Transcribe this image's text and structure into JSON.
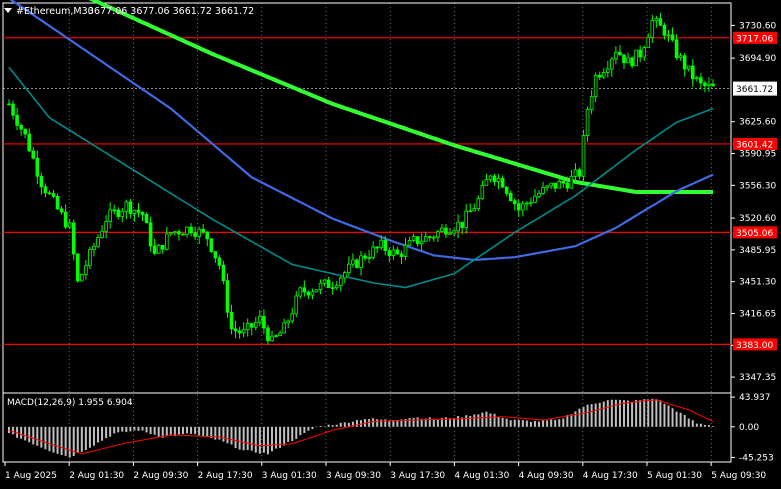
{
  "header": {
    "symbol_label": "#Ethereum,M30",
    "ohlc": "3677.06 3677.06 3661.72 3661.72",
    "menu_icon": "triangle-down-icon"
  },
  "chart_data": {
    "type": "candlestick",
    "timeframe": "M30",
    "colors": {
      "background": "#000000",
      "candles": "#00ff00",
      "ma_200": "#32ff32",
      "ma_blue": "#4169e1",
      "ma_teal": "#008b8b",
      "levels": "#ff0000",
      "grid": "#ffffff",
      "macd_hist": "#c0c0c0",
      "macd_signal": "#ff0000"
    },
    "price_axis": {
      "range": [
        3330,
        3755
      ],
      "ticks": [
        3730.6,
        3694.9,
        3625.6,
        3590.95,
        3556.3,
        3520.6,
        3485.95,
        3451.3,
        3416.65,
        3381.95,
        3347.35
      ]
    },
    "time_axis": {
      "labels": [
        "1 Aug 2025",
        "2 Aug 01:30",
        "2 Aug 09:30",
        "2 Aug 17:30",
        "3 Aug 01:30",
        "3 Aug 09:30",
        "3 Aug 17:30",
        "4 Aug 01:30",
        "4 Aug 09:30",
        "4 Aug 17:30",
        "5 Aug 01:30",
        "5 Aug 09:30"
      ]
    },
    "last_price": 3661.72,
    "horizontal_levels": [
      3717.06,
      3601.42,
      3505.06,
      3383.0
    ],
    "price_path": [
      {
        "t": 0,
        "p": 3645
      },
      {
        "t": 4,
        "p": 3610
      },
      {
        "t": 8,
        "p": 3560
      },
      {
        "t": 12,
        "p": 3530
      },
      {
        "t": 15,
        "p": 3510
      },
      {
        "t": 17,
        "p": 3450
      },
      {
        "t": 20,
        "p": 3480
      },
      {
        "t": 24,
        "p": 3520
      },
      {
        "t": 29,
        "p": 3535
      },
      {
        "t": 33,
        "p": 3525
      },
      {
        "t": 36,
        "p": 3480
      },
      {
        "t": 40,
        "p": 3505
      },
      {
        "t": 45,
        "p": 3510
      },
      {
        "t": 49,
        "p": 3500
      },
      {
        "t": 52,
        "p": 3470
      },
      {
        "t": 55,
        "p": 3400
      },
      {
        "t": 58,
        "p": 3395
      },
      {
        "t": 62,
        "p": 3410
      },
      {
        "t": 65,
        "p": 3385
      },
      {
        "t": 68,
        "p": 3400
      },
      {
        "t": 72,
        "p": 3440
      },
      {
        "t": 76,
        "p": 3445
      },
      {
        "t": 80,
        "p": 3450
      },
      {
        "t": 84,
        "p": 3465
      },
      {
        "t": 88,
        "p": 3480
      },
      {
        "t": 92,
        "p": 3490
      },
      {
        "t": 96,
        "p": 3480
      },
      {
        "t": 100,
        "p": 3495
      },
      {
        "t": 104,
        "p": 3500
      },
      {
        "t": 108,
        "p": 3510
      },
      {
        "t": 112,
        "p": 3515
      },
      {
        "t": 116,
        "p": 3540
      },
      {
        "t": 119,
        "p": 3570
      },
      {
        "t": 122,
        "p": 3560
      },
      {
        "t": 126,
        "p": 3530
      },
      {
        "t": 130,
        "p": 3545
      },
      {
        "t": 134,
        "p": 3555
      },
      {
        "t": 138,
        "p": 3560
      },
      {
        "t": 141,
        "p": 3570
      },
      {
        "t": 143,
        "p": 3640
      },
      {
        "t": 145,
        "p": 3675
      },
      {
        "t": 148,
        "p": 3690
      },
      {
        "t": 150,
        "p": 3705
      },
      {
        "t": 153,
        "p": 3690
      },
      {
        "t": 156,
        "p": 3700
      },
      {
        "t": 159,
        "p": 3735
      },
      {
        "t": 162,
        "p": 3725
      },
      {
        "t": 165,
        "p": 3700
      },
      {
        "t": 168,
        "p": 3680
      },
      {
        "t": 171,
        "p": 3665
      },
      {
        "t": 174,
        "p": 3662
      }
    ],
    "moving_averages": [
      {
        "id": "ma_200",
        "points": [
          {
            "t": 0,
            "p": 3790
          },
          {
            "t": 20,
            "p": 3760
          },
          {
            "t": 50,
            "p": 3700
          },
          {
            "t": 80,
            "p": 3645
          },
          {
            "t": 110,
            "p": 3600
          },
          {
            "t": 140,
            "p": 3560
          },
          {
            "t": 155,
            "p": 3549
          },
          {
            "t": 174,
            "p": 3549
          }
        ]
      },
      {
        "id": "ma_blue",
        "points": [
          {
            "t": 0,
            "p": 3760
          },
          {
            "t": 20,
            "p": 3700
          },
          {
            "t": 40,
            "p": 3640
          },
          {
            "t": 60,
            "p": 3565
          },
          {
            "t": 80,
            "p": 3520
          },
          {
            "t": 95,
            "p": 3495
          },
          {
            "t": 105,
            "p": 3480
          },
          {
            "t": 115,
            "p": 3475
          },
          {
            "t": 125,
            "p": 3478
          },
          {
            "t": 140,
            "p": 3490
          },
          {
            "t": 150,
            "p": 3510
          },
          {
            "t": 165,
            "p": 3550
          },
          {
            "t": 174,
            "p": 3568
          }
        ]
      },
      {
        "id": "ma_teal",
        "points": [
          {
            "t": 0,
            "p": 3685
          },
          {
            "t": 10,
            "p": 3630
          },
          {
            "t": 30,
            "p": 3575
          },
          {
            "t": 50,
            "p": 3520
          },
          {
            "t": 70,
            "p": 3470
          },
          {
            "t": 90,
            "p": 3450
          },
          {
            "t": 98,
            "p": 3445
          },
          {
            "t": 110,
            "p": 3460
          },
          {
            "t": 125,
            "p": 3505
          },
          {
            "t": 140,
            "p": 3545
          },
          {
            "t": 155,
            "p": 3595
          },
          {
            "t": 165,
            "p": 3625
          },
          {
            "t": 174,
            "p": 3640
          }
        ]
      }
    ],
    "macd": {
      "label": "MACD(12,26,9) 1.955 6.904",
      "ticks": [
        43.937,
        0.0,
        -45.253
      ],
      "range": [
        -52,
        50
      ],
      "histogram_path": [
        {
          "t": 0,
          "v": -10
        },
        {
          "t": 10,
          "v": -35
        },
        {
          "t": 15,
          "v": -45
        },
        {
          "t": 20,
          "v": -30
        },
        {
          "t": 26,
          "v": -10
        },
        {
          "t": 32,
          "v": -5
        },
        {
          "t": 38,
          "v": -15
        },
        {
          "t": 45,
          "v": -10
        },
        {
          "t": 52,
          "v": -20
        },
        {
          "t": 58,
          "v": -35
        },
        {
          "t": 64,
          "v": -40
        },
        {
          "t": 70,
          "v": -20
        },
        {
          "t": 76,
          "v": 0
        },
        {
          "t": 82,
          "v": 5
        },
        {
          "t": 88,
          "v": 12
        },
        {
          "t": 94,
          "v": 10
        },
        {
          "t": 100,
          "v": 14
        },
        {
          "t": 106,
          "v": 12
        },
        {
          "t": 112,
          "v": 15
        },
        {
          "t": 118,
          "v": 22
        },
        {
          "t": 124,
          "v": 10
        },
        {
          "t": 130,
          "v": 8
        },
        {
          "t": 136,
          "v": 10
        },
        {
          "t": 142,
          "v": 30
        },
        {
          "t": 148,
          "v": 40
        },
        {
          "t": 154,
          "v": 38
        },
        {
          "t": 160,
          "v": 42
        },
        {
          "t": 166,
          "v": 20
        },
        {
          "t": 170,
          "v": 5
        },
        {
          "t": 174,
          "v": 2
        }
      ],
      "signal_path": [
        {
          "t": 0,
          "v": -5
        },
        {
          "t": 10,
          "v": -25
        },
        {
          "t": 18,
          "v": -40
        },
        {
          "t": 28,
          "v": -25
        },
        {
          "t": 40,
          "v": -12
        },
        {
          "t": 52,
          "v": -15
        },
        {
          "t": 62,
          "v": -28
        },
        {
          "t": 70,
          "v": -25
        },
        {
          "t": 80,
          "v": -5
        },
        {
          "t": 90,
          "v": 8
        },
        {
          "t": 100,
          "v": 10
        },
        {
          "t": 112,
          "v": 12
        },
        {
          "t": 122,
          "v": 15
        },
        {
          "t": 132,
          "v": 10
        },
        {
          "t": 142,
          "v": 20
        },
        {
          "t": 152,
          "v": 35
        },
        {
          "t": 160,
          "v": 40
        },
        {
          "t": 168,
          "v": 25
        },
        {
          "t": 174,
          "v": 8
        }
      ]
    }
  }
}
